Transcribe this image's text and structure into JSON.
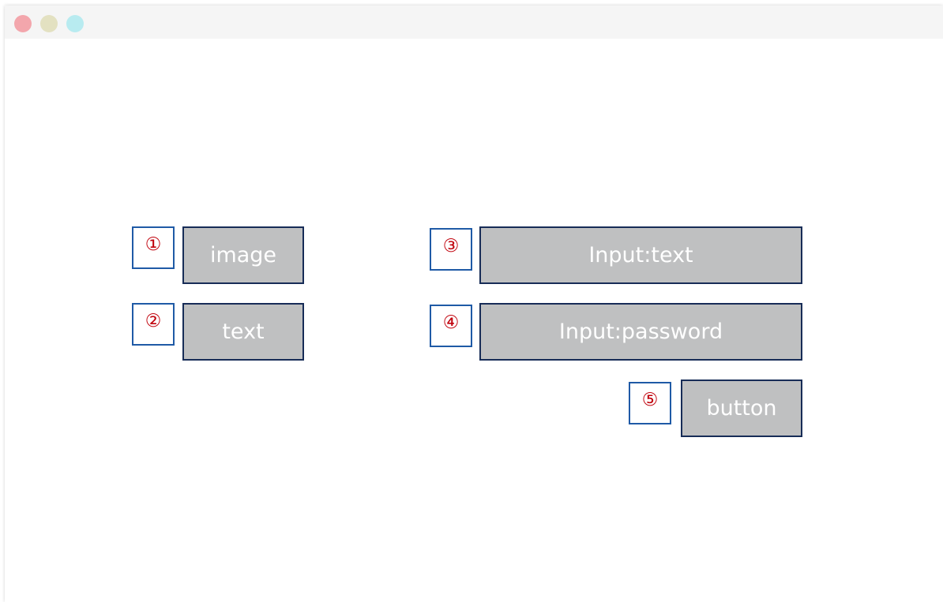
{
  "colors": {
    "window_dots": [
      "#f3a6ac",
      "#e3e1c1",
      "#b8ebf0"
    ],
    "number_text": "#c0000b",
    "number_box_border": "#1f5aa6",
    "gray_box_fill": "#bfc0c1",
    "gray_box_border": "#172c57",
    "label_text": "#ffffff"
  },
  "items": [
    {
      "number": "①",
      "label": "image"
    },
    {
      "number": "②",
      "label": "text"
    },
    {
      "number": "③",
      "label": "Input:text"
    },
    {
      "number": "④",
      "label": "Input:password"
    },
    {
      "number": "⑤",
      "label": "button"
    }
  ]
}
